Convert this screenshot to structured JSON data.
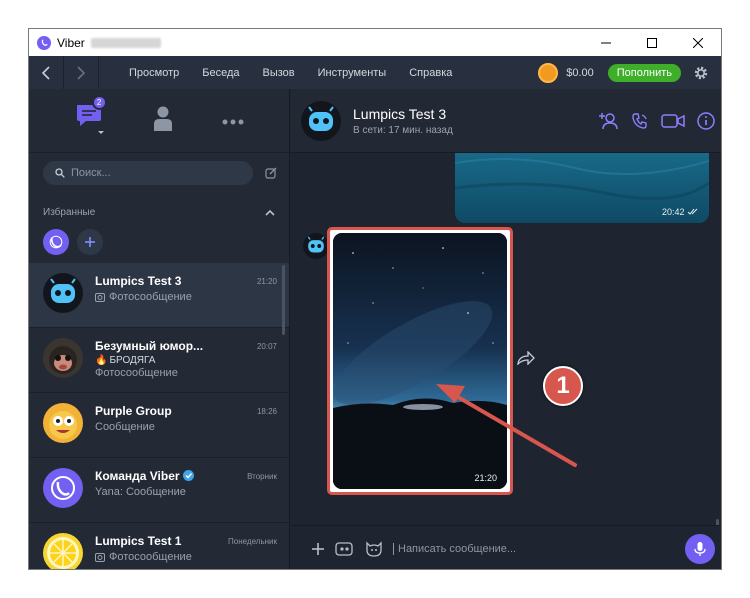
{
  "window": {
    "title": "Viber"
  },
  "menu": {
    "items": [
      "Просмотр",
      "Беседа",
      "Вызов",
      "Инструменты",
      "Справка"
    ],
    "balance": "$0.00",
    "topup_label": "Пополнить"
  },
  "sidebar": {
    "chat_badge": "2",
    "search_placeholder": "Поиск...",
    "favorites_title": "Избранные",
    "chats": [
      {
        "name": "Lumpics Test 3",
        "subtitle": "Фотосообщение",
        "time": "21:20"
      },
      {
        "name": "Безумный юмор...",
        "line1": "БРОДЯГА",
        "subtitle": "Фотосообщение",
        "time": "20:07"
      },
      {
        "name": "Purple Group",
        "subtitle": "Сообщение",
        "time": "18:26"
      },
      {
        "name": "Команда Viber",
        "subtitle": "Yana: Сообщение",
        "time": "Вторник"
      },
      {
        "name": "Lumpics Test 1",
        "subtitle": "Фотосообщение",
        "time": "Понедельник"
      }
    ]
  },
  "conversation": {
    "name": "Lumpics Test 3",
    "status": "В сети: 17 мин. назад",
    "sent_image_time": "20:42",
    "photo_time": "21:20",
    "callout_number": "1",
    "composer_placeholder": "Написать сообщение..."
  },
  "colors": {
    "accent": "#7360f2",
    "topup": "#3fae29",
    "callout": "#d7564d"
  }
}
